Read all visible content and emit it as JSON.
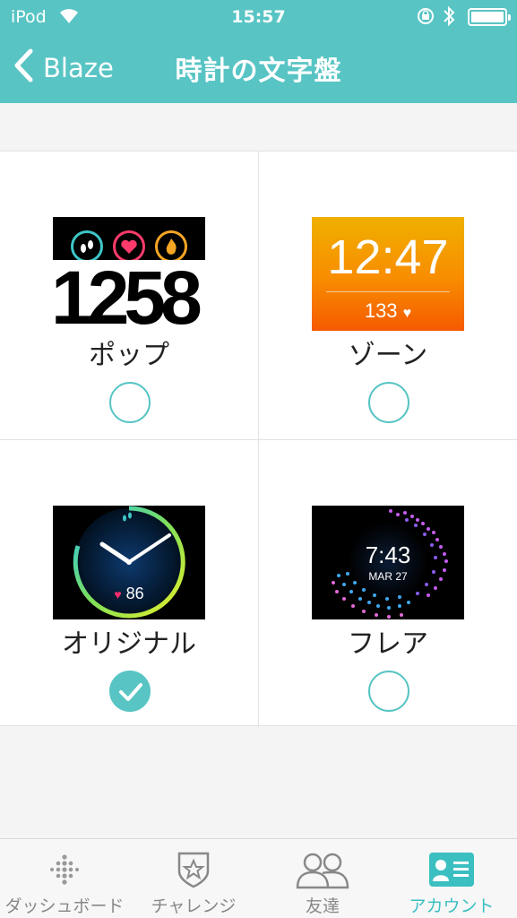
{
  "status_bar": {
    "carrier": "iPod",
    "time": "15:57"
  },
  "nav": {
    "back_label": "Blaze",
    "title": "時計の文字盤"
  },
  "clock_faces": [
    {
      "name": "ポップ",
      "selected": false,
      "preview": {
        "value": "1258"
      }
    },
    {
      "name": "ゾーン",
      "selected": false,
      "preview": {
        "time": "12:47",
        "heart_rate": "133"
      }
    },
    {
      "name": "オリジナル",
      "selected": true,
      "preview": {
        "heart_rate": "86"
      }
    },
    {
      "name": "フレア",
      "selected": false,
      "preview": {
        "time": "7:43",
        "date": "MAR 27"
      }
    }
  ],
  "tab_bar": {
    "tabs": [
      {
        "label": "ダッシュボード",
        "icon": "dashboard-dots-icon",
        "active": false
      },
      {
        "label": "チャレンジ",
        "icon": "challenge-badge-icon",
        "active": false
      },
      {
        "label": "友達",
        "icon": "friends-icon",
        "active": false
      },
      {
        "label": "アカウント",
        "icon": "account-card-icon",
        "active": true
      }
    ]
  },
  "colors": {
    "accent": "#58c4c4",
    "active_tab": "#3bbfc1",
    "inactive_tab": "#888888"
  }
}
